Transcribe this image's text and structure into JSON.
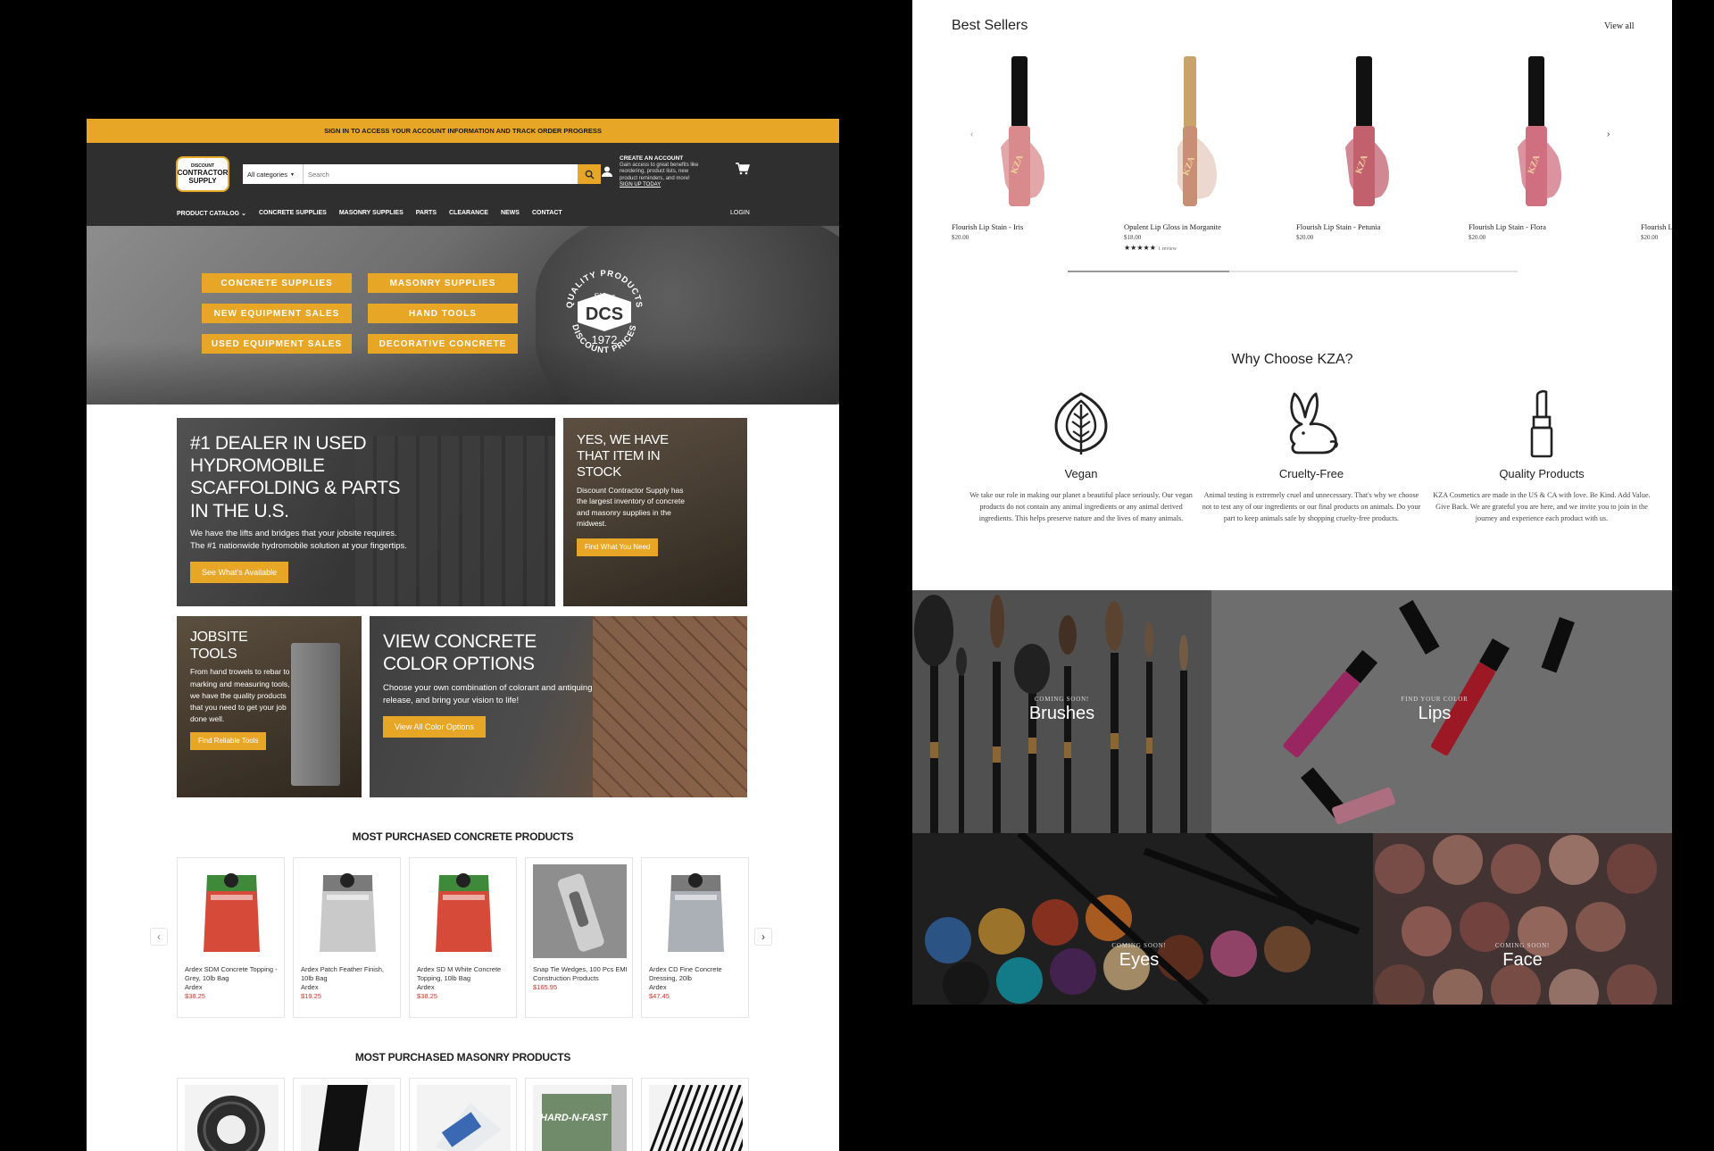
{
  "dcs": {
    "top_bar": "SIGN IN TO ACCESS YOUR ACCOUNT INFORMATION AND TRACK ORDER PROGRESS",
    "logo": {
      "line1": "DISCOUNT",
      "line2": "CONTRACTOR",
      "line3": "SUPPLY"
    },
    "search": {
      "category": "All categories",
      "placeholder": "Search"
    },
    "account": {
      "title": "CREATE AN ACCOUNT",
      "text": "Gain access to great benefits like reordering, product lists, new product reminders, and more!",
      "link": "SIGN UP TODAY"
    },
    "nav": [
      "PRODUCT CATALOG",
      "CONCRETE SUPPLIES",
      "MASONRY SUPPLIES",
      "PARTS",
      "CLEARANCE",
      "NEWS",
      "CONTACT"
    ],
    "login": "LOGIN",
    "hero_buttons": [
      "CONCRETE SUPPLIES",
      "MASONRY SUPPLIES",
      "NEW EQUIPMENT SALES",
      "HAND TOOLS",
      "USED EQUIPMENT SALES",
      "DECORATIVE CONCRETE"
    ],
    "badge": {
      "top": "QUALITY PRODUCTS",
      "since": "Since",
      "name": "DCS",
      "year": "1972",
      "bottom": "DISCOUNT PRICES"
    },
    "promos": {
      "scaffolding": {
        "title": "#1 DEALER IN USED HYDROMOBILE SCAFFOLDING & PARTS IN THE U.S.",
        "text": "We have the lifts and bridges that your jobsite requires. The #1 nationwide hydromobile solution at your fingertips.",
        "button": "See What's Available"
      },
      "stock": {
        "title": "YES, WE HAVE THAT ITEM IN STOCK",
        "text": "Discount Contractor Supply has the largest inventory of concrete and masonry supplies in the midwest.",
        "button": "Find What You Need"
      },
      "tools": {
        "title": "JOBSITE TOOLS",
        "text": "From hand trowels to rebar to marking and measuring tools, we have the quality products that you need to get your job done well.",
        "button": "Find Reliable Tools"
      },
      "color": {
        "title": "VIEW CONCRETE COLOR OPTIONS",
        "text": "Choose your own combination of colorant and antiquing release, and bring your vision to life!",
        "button": "View All Color Options"
      }
    },
    "concrete_title": "MOST PURCHASED CONCRETE PRODUCTS",
    "concrete_products": [
      {
        "name": "Ardex SDM Concrete Topping - Grey, 10lb Bag",
        "brand": "Ardex",
        "price": "$38.25",
        "color": "#d64a3a",
        "bag": "ARDEX SD-M"
      },
      {
        "name": "Ardex Patch Feather Finish, 10lb Bag",
        "brand": "Ardex",
        "price": "$19.25",
        "color": "#c9c9c9",
        "bag": "FEATHER FINISH"
      },
      {
        "name": "Ardex SD M White Concrete Topping, 10lb Bag",
        "brand": "Ardex",
        "price": "$38.25",
        "color": "#d64a3a",
        "bag": "ARDEX SD-M"
      },
      {
        "name": "Snap Tie Wedges, 100 Pcs EMI Construction Products",
        "brand": "",
        "price": "$165.95",
        "color": "#9a9a9a",
        "bag": ""
      },
      {
        "name": "Ardex CD Fine Concrete Dressing, 20lb",
        "brand": "Ardex",
        "price": "$47.45",
        "color": "#aab0b5",
        "bag": "ARDEX CD FINE"
      }
    ],
    "masonry_title": "MOST PURCHASED MASONRY PRODUCTS",
    "masonry_products": [
      {
        "label": ""
      },
      {
        "label": ""
      },
      {
        "label": ""
      },
      {
        "label": "HARD-N-FAST"
      },
      {
        "label": ""
      }
    ]
  },
  "kza": {
    "best_sellers_title": "Best Sellers",
    "view_all": "View all",
    "products": [
      {
        "name": "Flourish Lip Stain - Iris",
        "price": "$20.00",
        "color": "#d98a8c",
        "cap": "#111"
      },
      {
        "name": "Opulent Lip Gloss in Morganite",
        "price": "$18.00",
        "color": "#c98f74",
        "cap": "#c9a36a",
        "stars": "★★★★★",
        "reviews": "1 review"
      },
      {
        "name": "Flourish Lip Stain - Petunia",
        "price": "$20.00",
        "color": "#c2606d",
        "cap": "#111"
      },
      {
        "name": "Flourish Lip Stain - Flora",
        "price": "$20.00",
        "color": "#cf6f80",
        "cap": "#111"
      },
      {
        "name": "Flourish L",
        "price": "$20.00",
        "color": "#d07d80",
        "cap": "#111"
      }
    ],
    "why_title": "Why Choose KZA?",
    "features": [
      {
        "title": "Vegan",
        "text": "We take our role in making our planet a beautiful place seriously. Our vegan products do not contain any animal ingredients or any animal derived ingredients. This helps preserve nature and the lives of many animals."
      },
      {
        "title": "Cruelty-Free",
        "text": "Animal testing is extremely cruel and unnecessary. That's why we choose not to test any of our ingredients or our final products on animals. Do your part to keep animals safe by shopping cruelty-free products."
      },
      {
        "title": "Quality Products",
        "text": "KZA Cosmetics are made in the US & CA with love. Be Kind. Add Value. Give Back. We are grateful you are here, and we invite you to join in the journey and experience each product with us."
      }
    ],
    "tiles": [
      {
        "small": "COMING SOON!",
        "big": "Brushes"
      },
      {
        "small": "FIND YOUR COLOR",
        "big": "Lips"
      },
      {
        "small": "COMING SOON!",
        "big": "Eyes"
      },
      {
        "small": "COMING SOON!",
        "big": "Face"
      }
    ]
  }
}
